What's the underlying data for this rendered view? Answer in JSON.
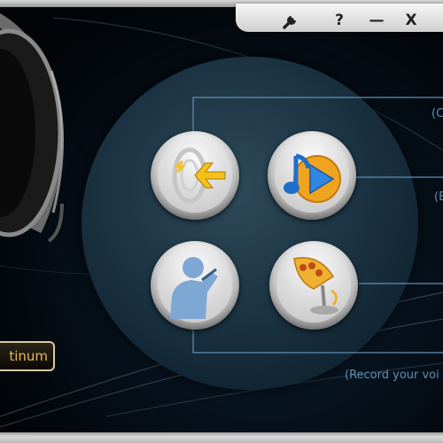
{
  "window": {
    "controls": [
      {
        "name": "settings-button",
        "icon": "wrench-icon",
        "glyph": ""
      },
      {
        "name": "help-button",
        "icon": "help-icon",
        "glyph": "?"
      },
      {
        "name": "minimize-button",
        "icon": "minimize-icon",
        "glyph": "—"
      },
      {
        "name": "close-button",
        "icon": "close-icon",
        "glyph": "X"
      }
    ]
  },
  "labels": {
    "top_right": "(C",
    "mid_right": "(E",
    "bottom": "(Record your voi"
  },
  "badge": {
    "text": "tinum"
  },
  "buttons": [
    {
      "name": "import-button",
      "icon": "speaker-arrow-icon"
    },
    {
      "name": "play-music-button",
      "icon": "music-note-play-icon"
    },
    {
      "name": "karaoke-button",
      "icon": "singer-icon"
    },
    {
      "name": "record-button",
      "icon": "microphone-icon"
    }
  ],
  "colors": {
    "accent_blue": "#5f8fb4",
    "gold": "#e6b85a",
    "icon_yellow": "#f3c117",
    "icon_blue": "#2c7fd6"
  }
}
